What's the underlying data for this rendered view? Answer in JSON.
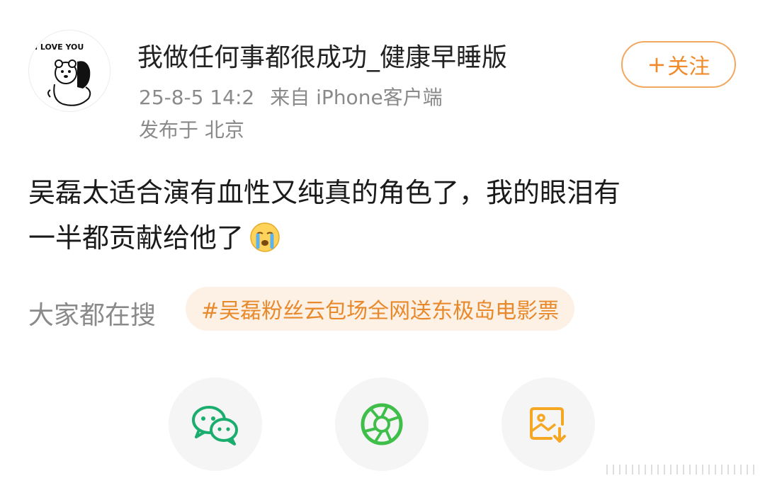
{
  "post": {
    "username": "我做任何事都很成功_健康早睡版",
    "timestamp": "25-8-5 14:2",
    "source": "来自 iPhone客户端",
    "location": "发布于 北京",
    "content_line1": "吴磊太适合演有血性又纯真的角色了，我的眼泪有",
    "content_line2": "一半都贡献给他了",
    "emoji": "crying-face-emoji"
  },
  "avatar": {
    "text": "I LOVE YOU"
  },
  "follow": {
    "plus": "+",
    "label": "关注"
  },
  "trending": {
    "label": "大家都在搜",
    "topic": "#吴磊粉丝云包场全网送东极岛电影票"
  },
  "share": {
    "wechat_icon": "wechat-icon",
    "moments_icon": "moments-aperture-icon",
    "save_image_icon": "save-image-icon",
    "colors": {
      "wechat": "#1aad6e",
      "moments": "#3fbf4a",
      "save": "#f5a623"
    }
  },
  "colors": {
    "accent": "#f08a2a",
    "chip_bg": "#fdf1e6",
    "meta": "#8a8a8a"
  }
}
